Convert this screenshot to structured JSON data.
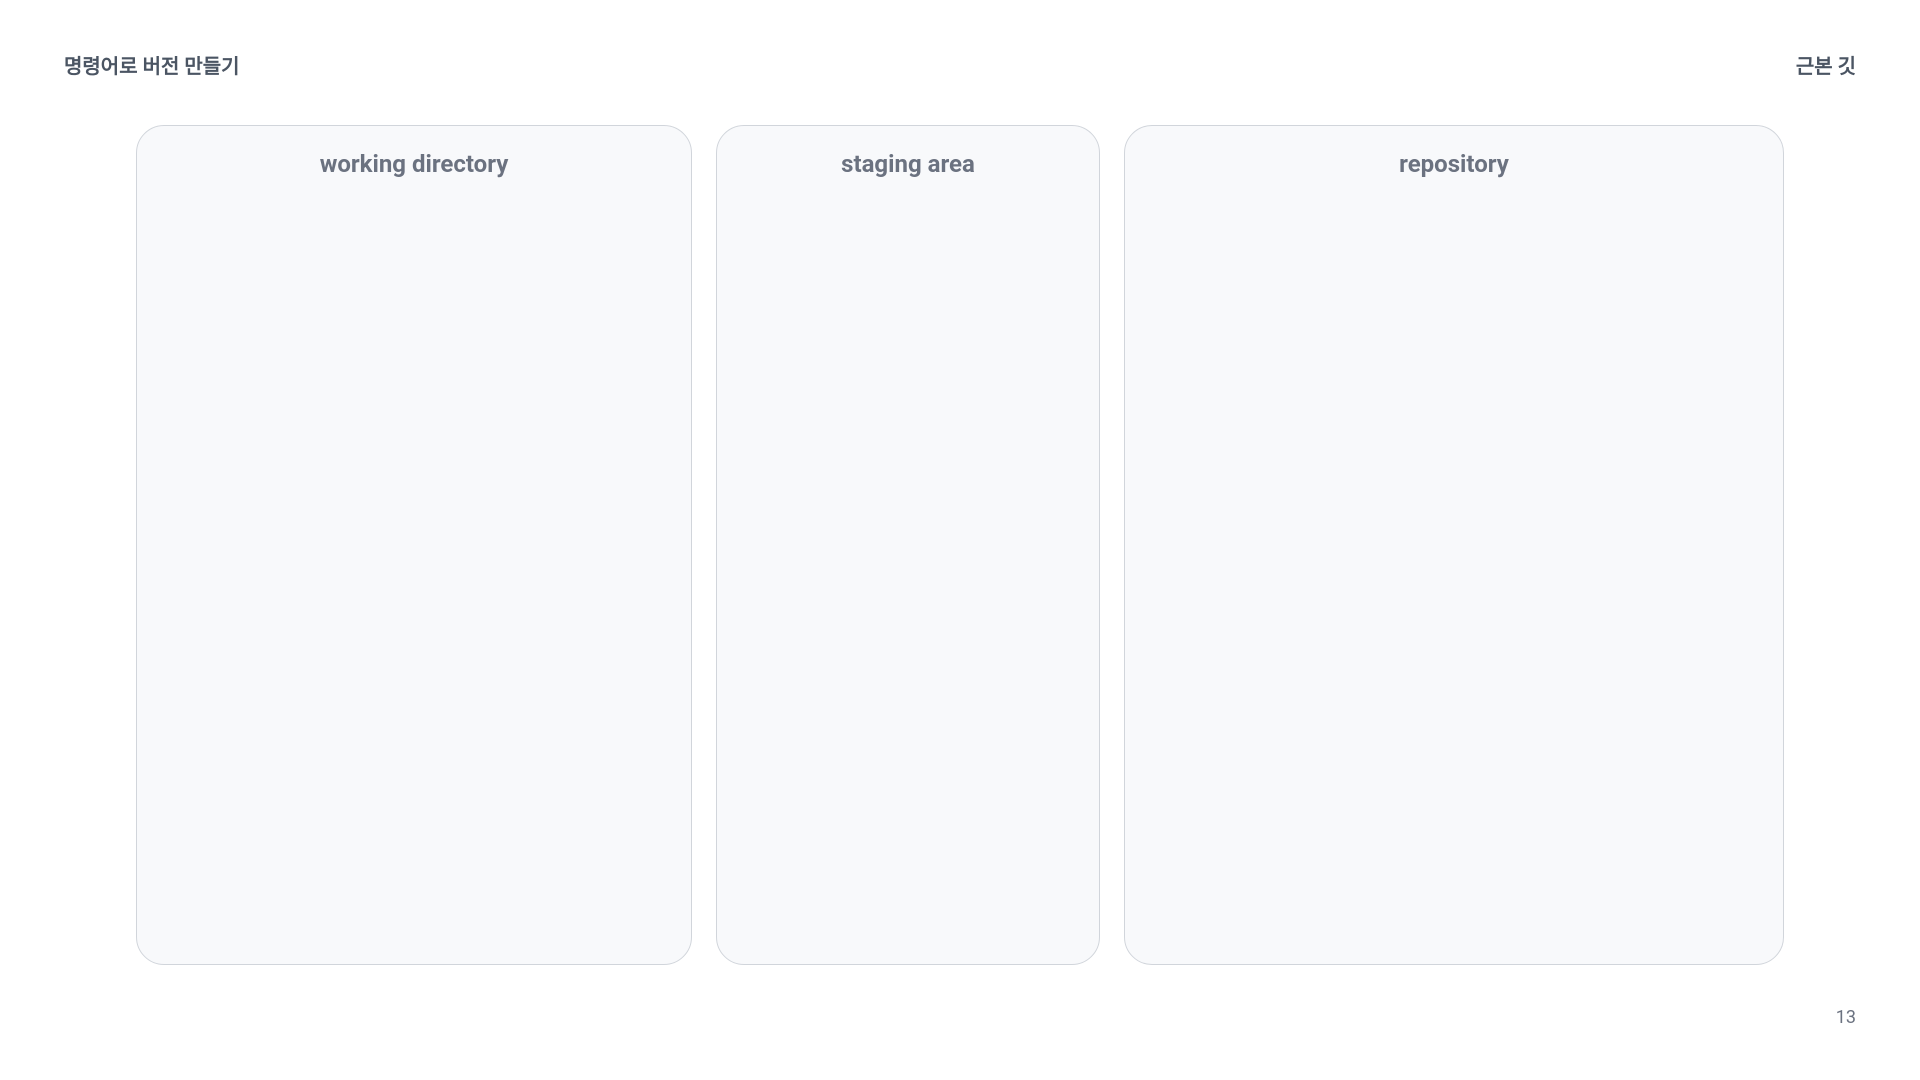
{
  "header": {
    "left_title": "명령어로 버전 만들기",
    "right_title": "근본 깃"
  },
  "panels": {
    "working_directory": {
      "title": "working directory"
    },
    "staging_area": {
      "title": "staging area"
    },
    "repository": {
      "title": "repository"
    }
  },
  "page_number": "13"
}
